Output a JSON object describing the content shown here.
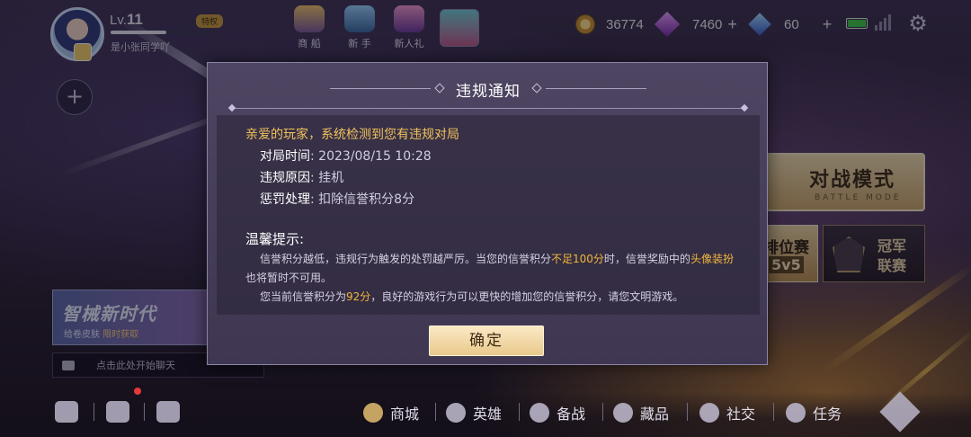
{
  "player": {
    "level_prefix": "Lv.",
    "level": "11",
    "privilege_badge": "特权",
    "nickname": "是小张同学吖",
    "exp_fraction": 0.52
  },
  "top_nav": [
    {
      "label": "商 船",
      "icon": "ship-icon"
    },
    {
      "label": "新 手",
      "icon": "novice-icon"
    },
    {
      "label": "新人礼",
      "icon": "gift-icon"
    }
  ],
  "currency": {
    "gold": "36774",
    "diamonds": "7460",
    "crystals": "60",
    "plus": "+"
  },
  "modes": {
    "battle_cn": "对战模式",
    "battle_en": "BATTLE MODE",
    "ranked_label": "排位赛",
    "ranked_mode": "5v5",
    "champion_line1": "冠军",
    "champion_line2": "联赛"
  },
  "promo": {
    "title": "智械新时代",
    "subtitle": "给卷皮肤",
    "subtitle_highlight": "限时获取"
  },
  "chat": {
    "placeholder": "点击此处开始聊天"
  },
  "bottom_nav": [
    {
      "label": "商城",
      "icon": "shop-icon"
    },
    {
      "label": "英雄",
      "icon": "hero-icon"
    },
    {
      "label": "备战",
      "icon": "prepare-icon"
    },
    {
      "label": "藏品",
      "icon": "collection-icon"
    },
    {
      "label": "社交",
      "icon": "social-icon"
    },
    {
      "label": "任务",
      "icon": "task-icon"
    }
  ],
  "dialog": {
    "title": "违规通知",
    "greeting": "亲爱的玩家，系统检测到您有违规对局",
    "match_time_label": "对局时间",
    "match_time_value": ": 2023/08/15 10:28",
    "reason_label": "违规原因",
    "reason_value": ": 挂机",
    "penalty_label": "惩罚处理",
    "penalty_value": ": 扣除信誉积分8分",
    "tips_title": "温馨提示:",
    "para1_a": "信誉积分越低，违规行为触发的处罚越严厉。当您的信誉积分",
    "para1_hl1": "不足100分",
    "para1_b": "时，信誉奖励中的",
    "para1_hl2": "头像装扮",
    "para1_c": "也将暂时不可用。",
    "para2_a": "您当前信誉积分为",
    "para2_hl": "92分",
    "para2_b": "，良好的游戏行为可以更快的增加您的信誉积分，请您文明游戏。",
    "confirm": "确定"
  }
}
